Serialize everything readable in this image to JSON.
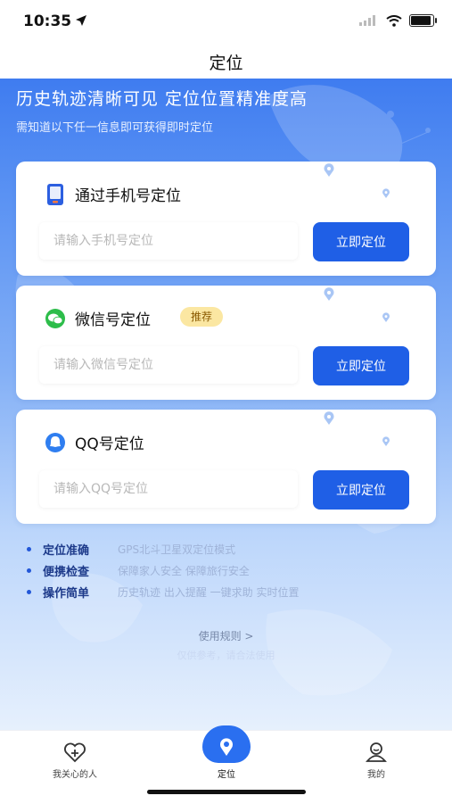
{
  "status_bar": {
    "time": "10:35"
  },
  "nav": {
    "title": "定位"
  },
  "hero": {
    "title": "历史轨迹清晰可见  定位位置精准度高",
    "subtitle": "需知道以下任一信息即可获得即时定位"
  },
  "cards": [
    {
      "title": "通过手机号定位",
      "placeholder": "请输入手机号定位",
      "button": "立即定位",
      "icon": "phone-icon"
    },
    {
      "title": "微信号定位",
      "badge": "推荐",
      "placeholder": "请输入微信号定位",
      "button": "立即定位",
      "icon": "wechat-icon"
    },
    {
      "title": "QQ号定位",
      "placeholder": "请输入QQ号定位",
      "button": "立即定位",
      "icon": "qq-icon"
    }
  ],
  "features": [
    {
      "title": "定位准确",
      "desc": "GPS北斗卫星双定位模式"
    },
    {
      "title": "便携检查",
      "desc": "保障家人安全  保障旅行安全"
    },
    {
      "title": "操作简单",
      "desc": "历史轨迹  出入提醒  一键求助  实时位置"
    }
  ],
  "rules_link": "使用规则 >",
  "rules_faint": "仅供参考，请合法使用",
  "tabs": [
    {
      "label": "我关心的人",
      "icon": "heart-plus-icon"
    },
    {
      "label": "定位",
      "icon": "location-icon"
    },
    {
      "label": "我的",
      "icon": "profile-icon"
    }
  ],
  "colors": {
    "primary": "#1f5fe6",
    "badge_bg": "#fbe7a2",
    "hero_top": "#3f7cf0"
  }
}
